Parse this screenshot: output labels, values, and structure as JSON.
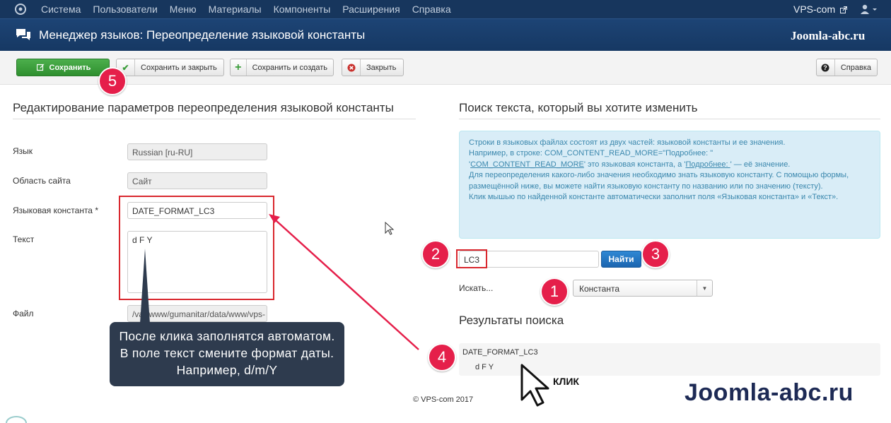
{
  "topnav": {
    "menu": [
      "Система",
      "Пользователи",
      "Меню",
      "Материалы",
      "Компоненты",
      "Расширения",
      "Справка"
    ],
    "site": "VPS-com"
  },
  "header": {
    "title": "Менеджер языков: Переопределение языковой константы",
    "brand": "Joomla-abc.ru"
  },
  "toolbar": {
    "save": "Сохранить",
    "save_close": "Сохранить и закрыть",
    "save_new": "Сохранить и создать",
    "close": "Закрыть",
    "help": "Справка"
  },
  "left": {
    "heading": "Редактирование параметров переопределения языковой константы",
    "language_label": "Язык",
    "language_value": "Russian [ru-RU]",
    "client_label": "Область сайта",
    "client_value": "Сайт",
    "key_label": "Языковая константа *",
    "key_value": "DATE_FORMAT_LC3",
    "text_label": "Текст",
    "text_value": "d F Y",
    "file_label": "Файл",
    "file_value": "/var/www/gumanitar/data/www/vps-"
  },
  "right": {
    "heading": "Поиск текста, который вы хотите изменить",
    "info": {
      "line1": "Строки в языковых файлах состоят из двух частей: языковой константы и ее значения.",
      "line2": "Например, в строке: COM_CONTENT_READ_MORE=\"Подробнее: \"",
      "line3_q1": "'",
      "line3_key": "COM_CONTENT_READ_MORE",
      "line3_mid": "' это языковая константа, а '",
      "line3_val": "Подробнее: ",
      "line3_end": "' — её значение.",
      "line4": "Для переопределения какого-либо значения необходимо знать языковую константу. С помощью формы, размещённой ниже, вы можете найти языковую константу по названию или по значению (тексту).",
      "line5": "Клик мышью по найденной константе автоматически заполнит поля «Языковая константа» и «Текст»."
    },
    "search_value": "LC3",
    "find_button": "Найти",
    "search_in_label": "Искать...",
    "search_in_value": "Константа",
    "results_heading": "Результаты поиска",
    "result_key": "DATE_FORMAT_LC3",
    "result_value": "d F Y"
  },
  "footer": "© VPS-com 2017",
  "annotations": {
    "tooltip": "После клика заполнятся автоматом. В поле текст смените формат даты. Например, d/m/Y",
    "klik": "КЛИК",
    "brand": "Joomla-abc.ru",
    "badges": [
      "1",
      "2",
      "3",
      "4",
      "5"
    ]
  },
  "colors": {
    "nav_bg": "#17365d",
    "save_green": "#3a9d3a",
    "find_blue": "#2275c2",
    "badge_red": "#e51f4a",
    "highlight_red": "#d9272e",
    "tooltip_bg": "#2e3b4e"
  }
}
